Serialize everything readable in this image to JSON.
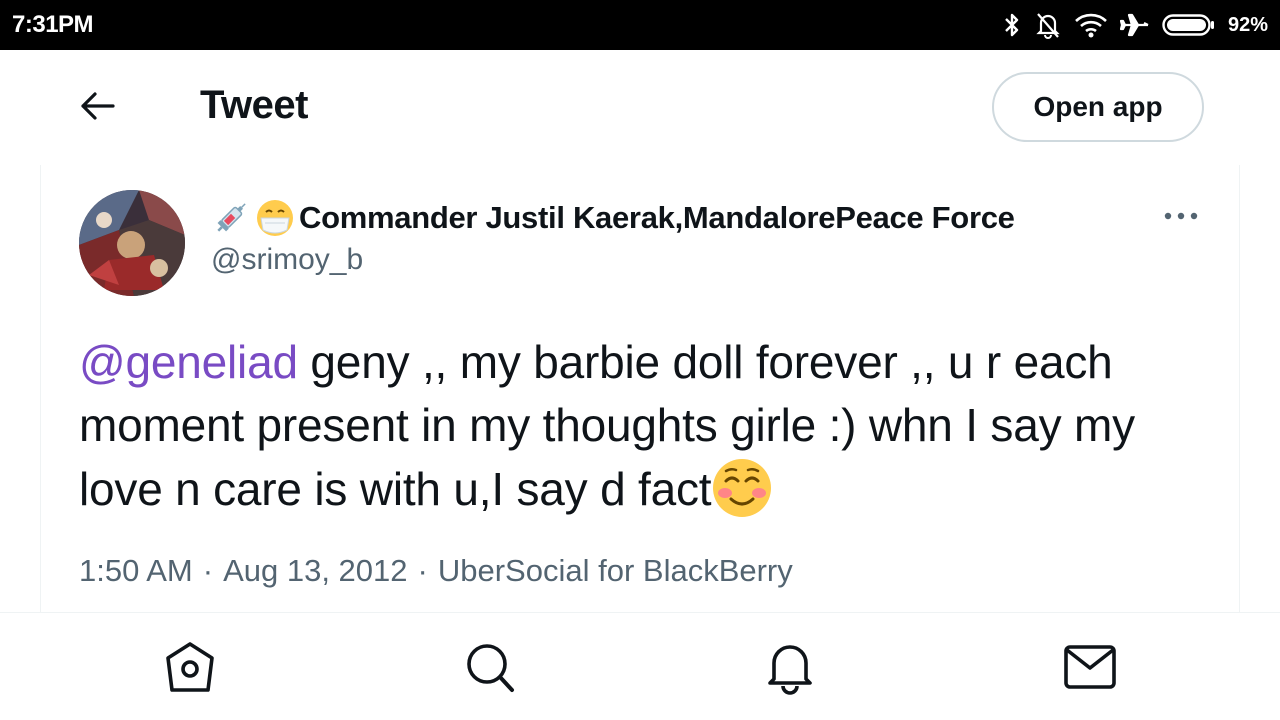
{
  "status_bar": {
    "time": "7:31PM",
    "battery_percent": "92%",
    "icons": [
      "bluetooth-icon",
      "mute-bell-icon",
      "wifi-icon",
      "airplane-mode-icon",
      "battery-icon"
    ]
  },
  "header": {
    "title": "Tweet",
    "open_app_label": "Open app",
    "back_icon": "back-arrow-icon"
  },
  "tweet": {
    "name_emojis": [
      "syringe-emoji",
      "mask-face-emoji"
    ],
    "display_name": "Commander Justil Kaerak,MandalorePeace Force",
    "handle": "@srimoy_b",
    "mention": "@geneliad",
    "body": " geny ,, my barbie doll forever ,, u r each moment present in my thoughts girle :) whn I say my love n care is with u,I say d fact",
    "trailing_emoji": "smiling-blush-emoji",
    "time": "1:50 AM",
    "date": "Aug 13, 2012",
    "source": "UberSocial for BlackBerry",
    "separator": "·"
  },
  "bottom_nav": {
    "items": [
      "home-icon",
      "search-icon",
      "notifications-icon",
      "messages-icon"
    ]
  },
  "colors": {
    "accent": "#794bc4",
    "text_primary": "#0f1419",
    "text_secondary": "#536471",
    "border": "#cfd9de"
  }
}
